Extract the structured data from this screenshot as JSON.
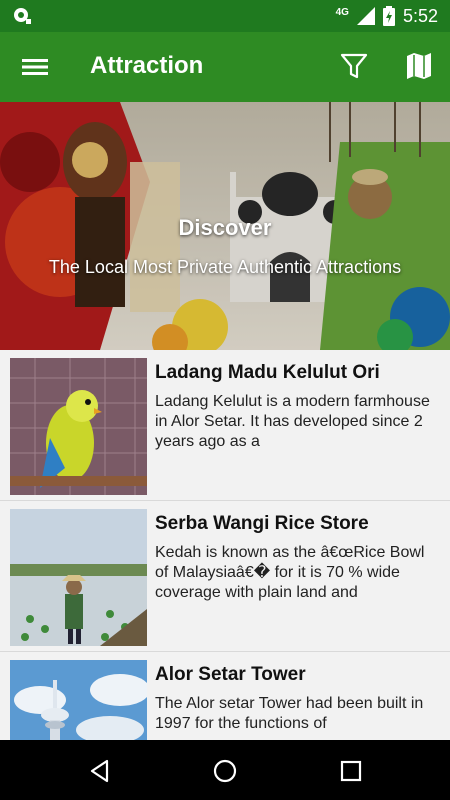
{
  "status_bar": {
    "network": "4G",
    "time": "5:52"
  },
  "app_bar": {
    "title": "Attraction",
    "icons": [
      "menu-icon",
      "filter-icon",
      "map-icon"
    ]
  },
  "hero": {
    "title": "Discover",
    "subtitle": "The Local Most Private Authentic Attractions"
  },
  "attractions": [
    {
      "name": "Ladang Madu Kelulut Ori",
      "description": "Ladang Kelulut is a modern farmhouse in Alor Setar. It has developed since 2 years ago as a"
    },
    {
      "name": "Serba Wangi Rice Store",
      "description": "Kedah is known as the â€œRice Bowl of Malaysiaâ€� for it is 70 % wide coverage with plain land and"
    },
    {
      "name": "Alor Setar Tower",
      "description": "The Alor setar Tower had been built in 1997 for the functions of"
    }
  ],
  "colors": {
    "status_bar": "#1f7a1f",
    "app_bar": "#2e8b23"
  }
}
